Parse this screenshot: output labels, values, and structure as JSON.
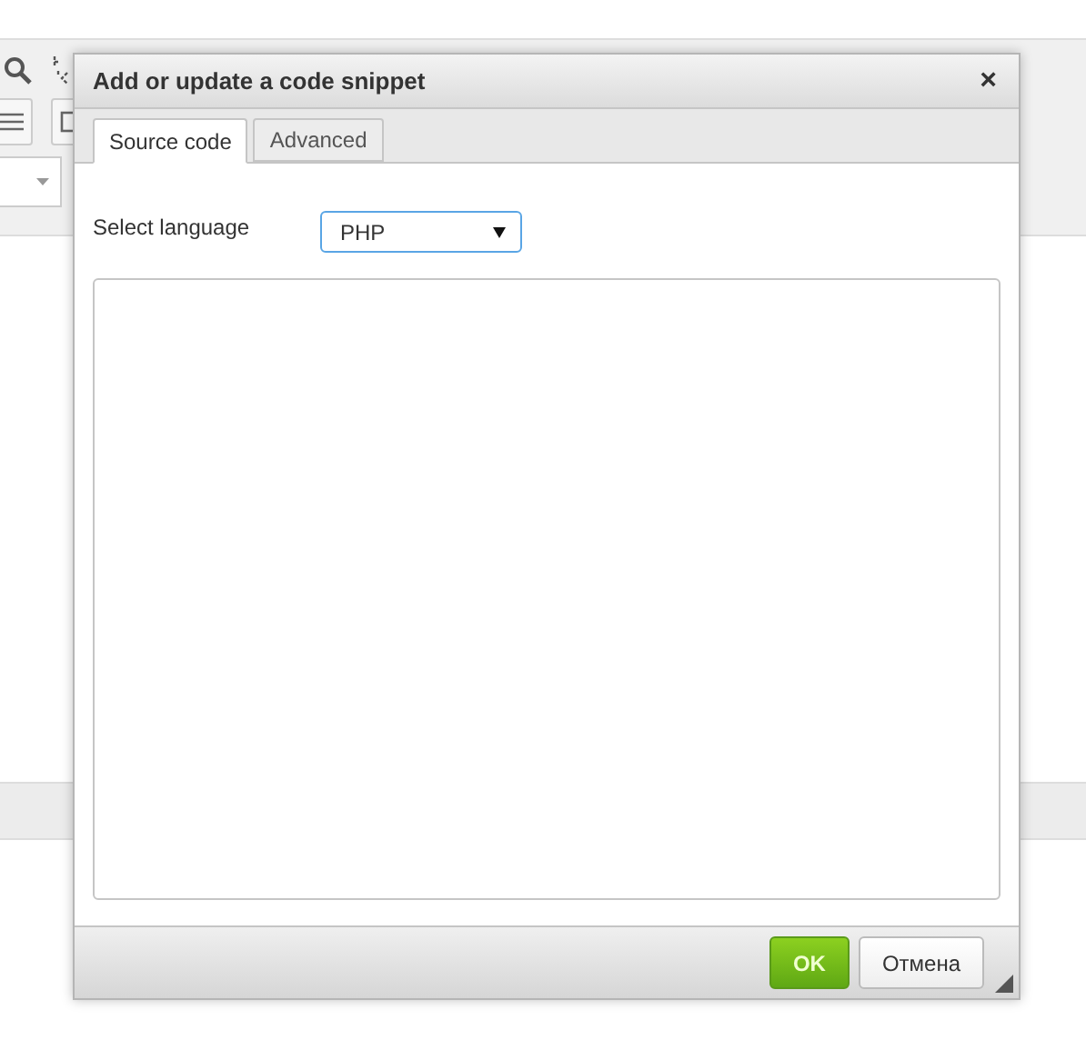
{
  "dialog": {
    "title": "Add or update a code snippet",
    "close": "×",
    "tabs": [
      {
        "label": "Source code",
        "selected": true
      },
      {
        "label": "Advanced",
        "selected": false
      }
    ],
    "language": {
      "label": "Select language",
      "value": "PHP"
    },
    "buttons": [
      {
        "label": "OK",
        "kind": "primary"
      },
      {
        "label": "Отмена",
        "kind": "secondary"
      }
    ]
  }
}
